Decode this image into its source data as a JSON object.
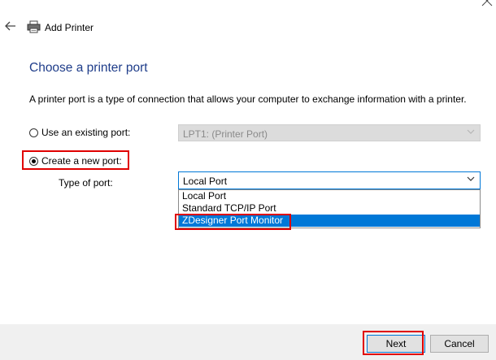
{
  "window": {
    "title": "Add Printer",
    "close_glyph": "✕"
  },
  "page": {
    "heading": "Choose a printer port",
    "description": "A printer port is a type of connection that allows your computer to exchange information with a printer."
  },
  "options": {
    "existing_label": "Use an existing port:",
    "existing_value": "LPT1: (Printer Port)",
    "new_label": "Create a new port:",
    "type_label": "Type of port:",
    "type_value": "Local Port",
    "type_options": [
      "Local Port",
      "Standard TCP/IP Port",
      "ZDesigner Port Monitor"
    ],
    "selected_index": 2
  },
  "buttons": {
    "next": "Next",
    "cancel": "Cancel"
  },
  "colors": {
    "accent": "#0078d7",
    "highlight": "#e00000",
    "heading": "#1f3d8a"
  }
}
